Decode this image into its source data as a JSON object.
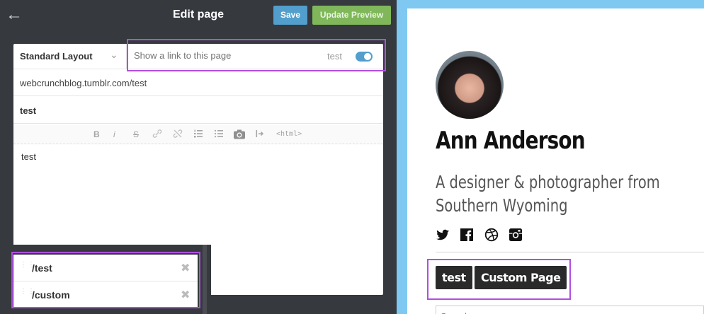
{
  "editor": {
    "title": "Edit page",
    "save_label": "Save",
    "preview_label": "Update Preview",
    "layout_label": "Standard Layout",
    "link_placeholder": "Show a link to this page",
    "toggle_label": "test",
    "url": "webcrunchblog.tumblr.com/test",
    "page_title": "test",
    "toolbar": [
      "B",
      "i",
      "S",
      "link",
      "unlink",
      "ordered-list",
      "bullet-list",
      "camera",
      "read-more",
      "<html>"
    ],
    "body": "test",
    "html_label": "<html>"
  },
  "pages": [
    {
      "label": "/test"
    },
    {
      "label": "/custom"
    }
  ],
  "preview": {
    "name": "Ann Anderson",
    "bio": "A designer & photographer from Southern Wyoming",
    "social": [
      "twitter-icon",
      "facebook-icon",
      "dribbble-icon",
      "instagram-icon"
    ],
    "tags": [
      "test",
      "Custom Page"
    ],
    "search_placeholder": "Search"
  },
  "colors": {
    "panel_bg": "#36393e",
    "save_blue": "#529ecc",
    "preview_green": "#7fb75a",
    "highlight_purple": "#b14ee0",
    "frame_blue": "#7ec8f2"
  }
}
